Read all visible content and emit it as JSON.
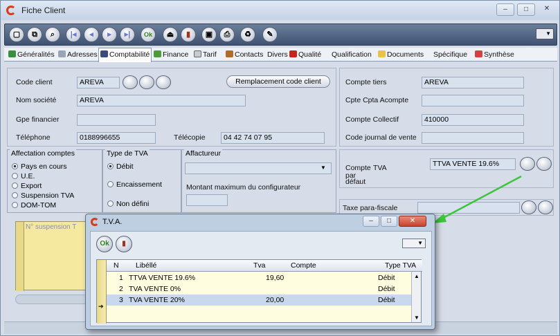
{
  "window": {
    "title": "Fiche Client",
    "min": "‒",
    "max": "□",
    "close": "✕"
  },
  "toolbar": {
    "ok_label": "Ok"
  },
  "tabs": [
    {
      "label": "Généralités"
    },
    {
      "label": "Adresses"
    },
    {
      "label": "Comptabilité"
    },
    {
      "label": "Finance"
    },
    {
      "label": "Tarif"
    },
    {
      "label": "Contacts"
    },
    {
      "label": "Divers"
    },
    {
      "label": "Qualité"
    },
    {
      "label": "Qualification"
    },
    {
      "label": "Documents"
    },
    {
      "label": "Spécifique"
    },
    {
      "label": "Synthèse"
    }
  ],
  "client": {
    "code_label": "Code client",
    "code_value": "AREVA",
    "replace_button": "Remplacement code client",
    "societe_label": "Nom société",
    "societe_value": "AREVA",
    "gpe_label": "Gpe financier",
    "gpe_value": "",
    "tel_label": "Téléphone",
    "tel_value": "0188996655",
    "fax_label": "Télécopie",
    "fax_value": "04 42 74 07 95"
  },
  "compte": {
    "tiers_label": "Compte tiers",
    "tiers_value": "AREVA",
    "acompte_label": "Cpte Cpta Acompte",
    "acompte_value": "",
    "collectif_label": "Compte Collectif",
    "collectif_value": "410000",
    "journal_label": "Code journal de vente",
    "journal_value": ""
  },
  "affectation": {
    "title": "Affectation comptes",
    "options": [
      "Pays en cours",
      "U.E.",
      "Export",
      "Suspension TVA",
      "DOM-TOM"
    ],
    "selected": 0
  },
  "type_tva": {
    "title": "Type de TVA",
    "options": [
      "Débit",
      "Encaissement",
      "Non défini"
    ],
    "selected": 0
  },
  "affactureur": {
    "title": "Affactureur",
    "value": ""
  },
  "montant": {
    "title": "Montant maximum du configurateur",
    "value": ""
  },
  "tva_defaut": {
    "label1": "Compte",
    "label2": "TVA",
    "label3": "par",
    "label4": "défaut",
    "value": "TTVA VENTE 19.6%"
  },
  "taxe": {
    "label": "Taxe para-fiscale",
    "value": ""
  },
  "background_grid": {
    "header": "N° suspension T"
  },
  "dialog": {
    "title": "T.V.A.",
    "ok_label": "Ok",
    "columns": [
      "N",
      "Libéllé",
      "Tva",
      "Compte",
      "Type TVA"
    ],
    "rows": [
      {
        "n": "1",
        "libelle": "TTVA VENTE 19.6%",
        "tva": "19,60",
        "compte": "",
        "type": "Débit"
      },
      {
        "n": "2",
        "libelle": "TVA VENTE 0%",
        "tva": "",
        "compte": "",
        "type": "Débit"
      },
      {
        "n": "3",
        "libelle": "TVA VENTE 20%",
        "tva": "20,00",
        "compte": "",
        "type": "Débit"
      }
    ],
    "selected_row": 2,
    "close": "✕",
    "min": "‒",
    "max": "□"
  },
  "colors": {
    "accent_arrow": "#3cc43c",
    "selected_row": "#c9d8ee"
  }
}
